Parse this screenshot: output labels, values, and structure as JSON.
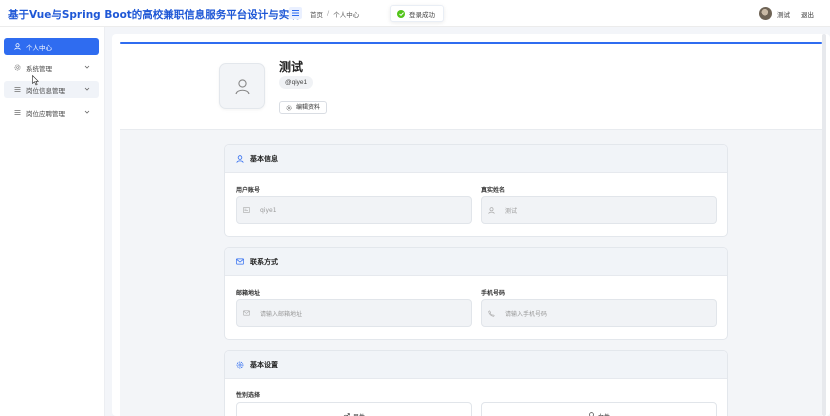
{
  "header": {
    "app_title": "基于Vue与Spring Boot的高校兼职信息服务平台设计与实现",
    "breadcrumb": [
      "首页",
      "个人中心"
    ],
    "breadcrumb_sep": "/",
    "toast": "登录成功",
    "user_name": "测试",
    "logout": "退出"
  },
  "sidebar": {
    "items": [
      {
        "label": "个人中心",
        "icon": "user-icon",
        "active": true
      },
      {
        "label": "系统管理",
        "icon": "gear-icon",
        "expandable": true
      },
      {
        "label": "岗位信息管理",
        "icon": "list-icon",
        "expandable": true
      },
      {
        "label": "岗位应聘管理",
        "icon": "list-icon",
        "expandable": true
      }
    ]
  },
  "profile": {
    "name": "测试",
    "handle": "@qiye1",
    "edit_label": "编辑资料"
  },
  "sections": {
    "basic": {
      "title": "基本信息",
      "account_label": "用户账号",
      "account_value": "qiye1",
      "realname_label": "真实姓名",
      "realname_value": "测试"
    },
    "contact": {
      "title": "联系方式",
      "email_label": "邮箱地址",
      "email_placeholder": "请输入邮箱地址",
      "phone_label": "手机号码",
      "phone_placeholder": "请输入手机号码"
    },
    "settings": {
      "title": "基本设置",
      "gender_label": "性别选择",
      "male": "男性",
      "female": "女性"
    }
  },
  "colors": {
    "accent": "#2f6cf0",
    "title": "#1e57d6",
    "success": "#52c41a"
  }
}
